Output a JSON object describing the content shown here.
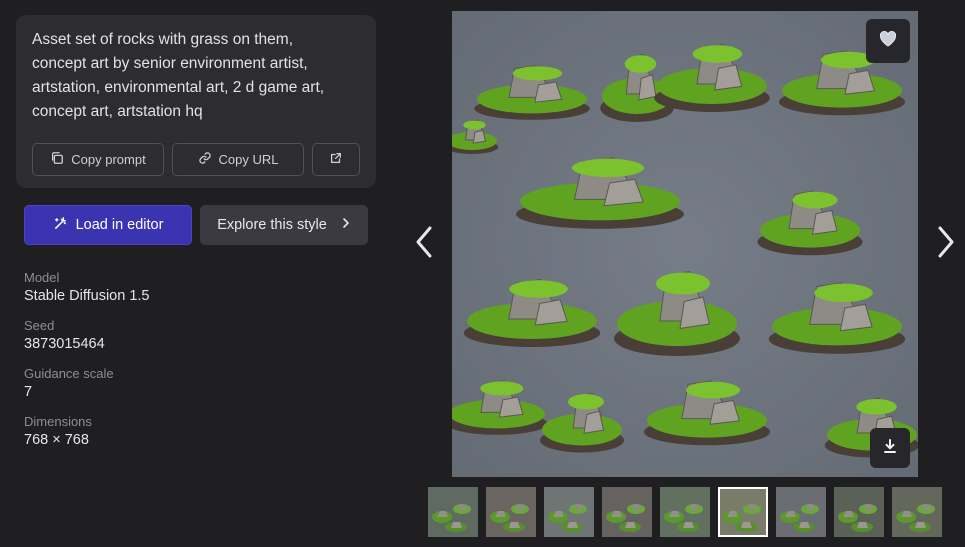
{
  "prompt": {
    "lines": [
      "Asset set of rocks with grass on them,",
      "concept art by senior environment artist,",
      "artstation, environmental art, 2 d game art,",
      "concept art, artstation hq"
    ],
    "copy_prompt_label": "Copy prompt",
    "copy_url_label": "Copy URL",
    "open_icon": "external-link-icon"
  },
  "actions": {
    "load_label": "Load in editor",
    "explore_label": "Explore this style"
  },
  "details": [
    {
      "label": "Model",
      "value": "Stable Diffusion 1.5"
    },
    {
      "label": "Seed",
      "value": "3873015464"
    },
    {
      "label": "Guidance scale",
      "value": "7"
    },
    {
      "label": "Dimensions",
      "value": "768 × 768"
    }
  ],
  "colors": {
    "accent": "#3b34b0",
    "background": "#1f1f22",
    "card": "#2c2c31",
    "image_bg": "#6c737d",
    "grass": "#5fa321",
    "rock": "#8e8a86"
  },
  "thumbnails": {
    "count": 9,
    "active_index": 5
  },
  "icons": {
    "favorite": "heart-icon",
    "download": "download-icon",
    "prev": "chevron-left-icon",
    "next": "chevron-right-icon"
  }
}
